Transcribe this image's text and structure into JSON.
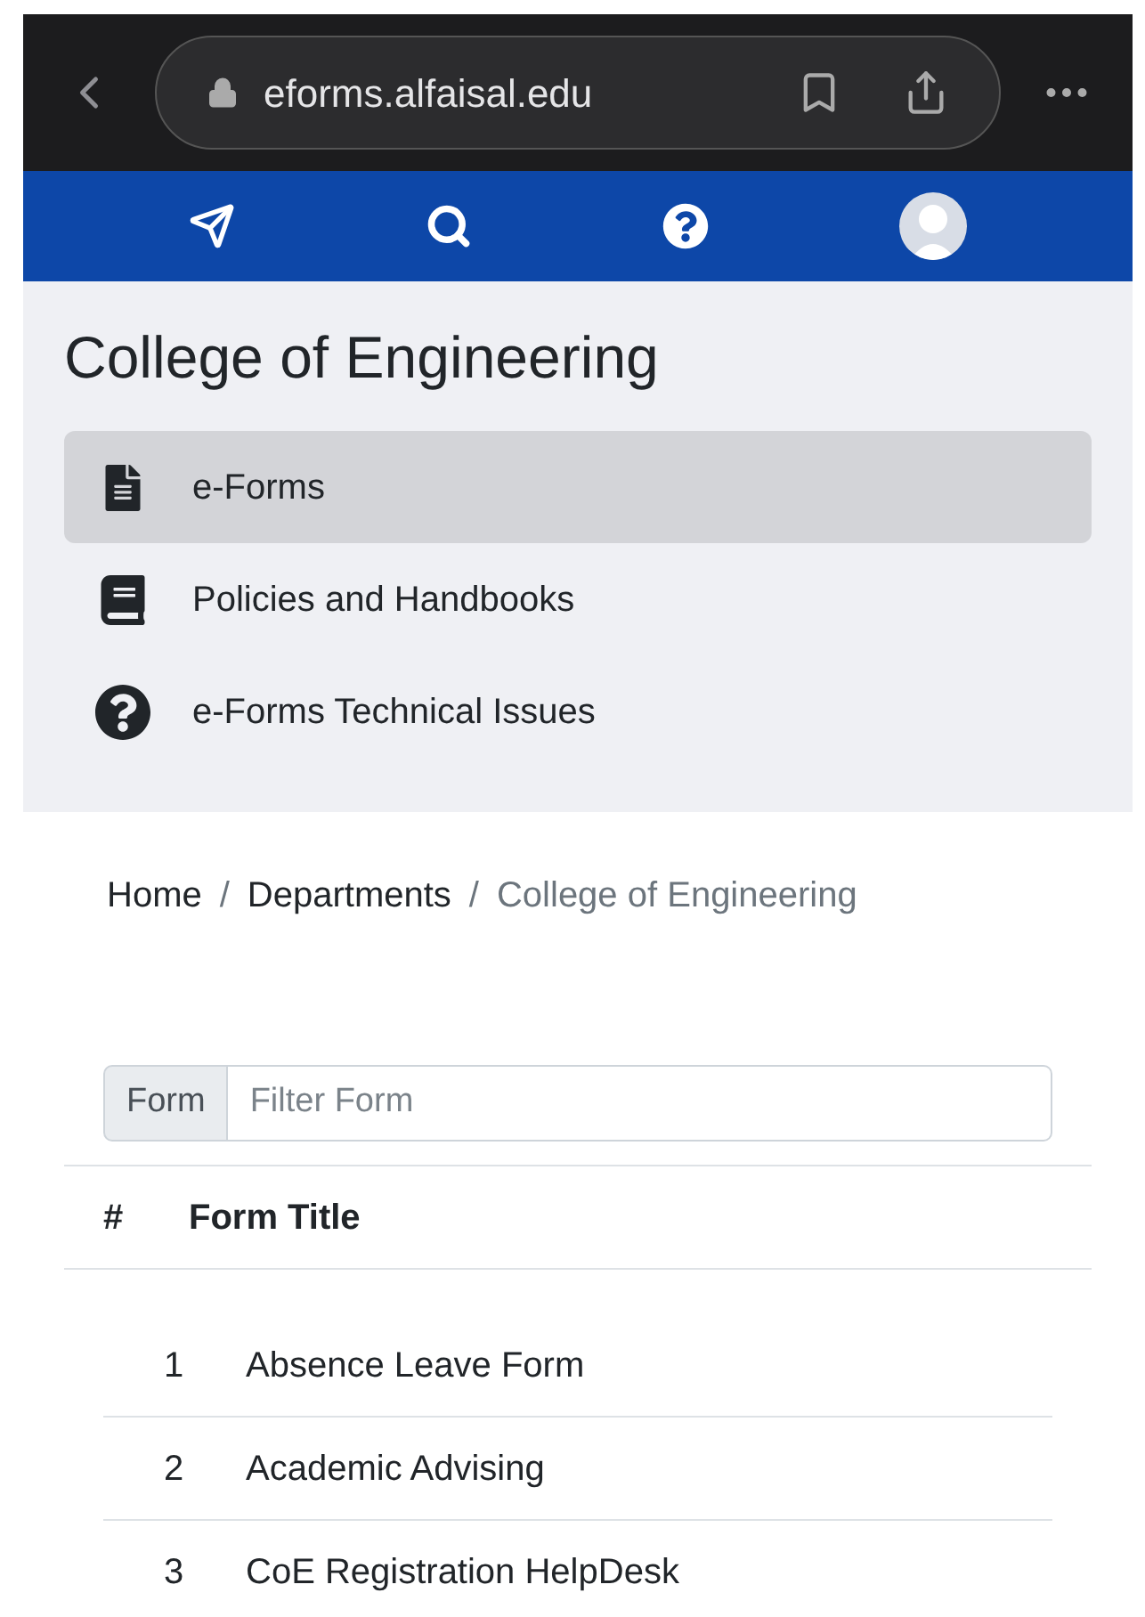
{
  "browser": {
    "url": "eforms.alfaisal.edu"
  },
  "sidebar": {
    "title": "College of Engineering",
    "items": [
      {
        "label": "e-Forms",
        "kind": "file",
        "selected": true
      },
      {
        "label": "Policies and Handbooks",
        "kind": "book",
        "selected": false
      },
      {
        "label": "e-Forms Technical Issues",
        "kind": "help",
        "selected": false
      }
    ]
  },
  "breadcrumb": [
    {
      "label": "Home",
      "active": false
    },
    {
      "label": "Departments",
      "active": false
    },
    {
      "label": "College of Engineering",
      "active": true
    }
  ],
  "breadcrumb_separator": "/",
  "filter": {
    "label": "Form",
    "placeholder": "Filter Form"
  },
  "table": {
    "columns": [
      "#",
      "Form Title"
    ],
    "rows": [
      {
        "number": "1",
        "title": "Absence Leave Form"
      },
      {
        "number": "2",
        "title": "Academic Advising"
      },
      {
        "number": "3",
        "title": "CoE Registration HelpDesk"
      }
    ]
  }
}
